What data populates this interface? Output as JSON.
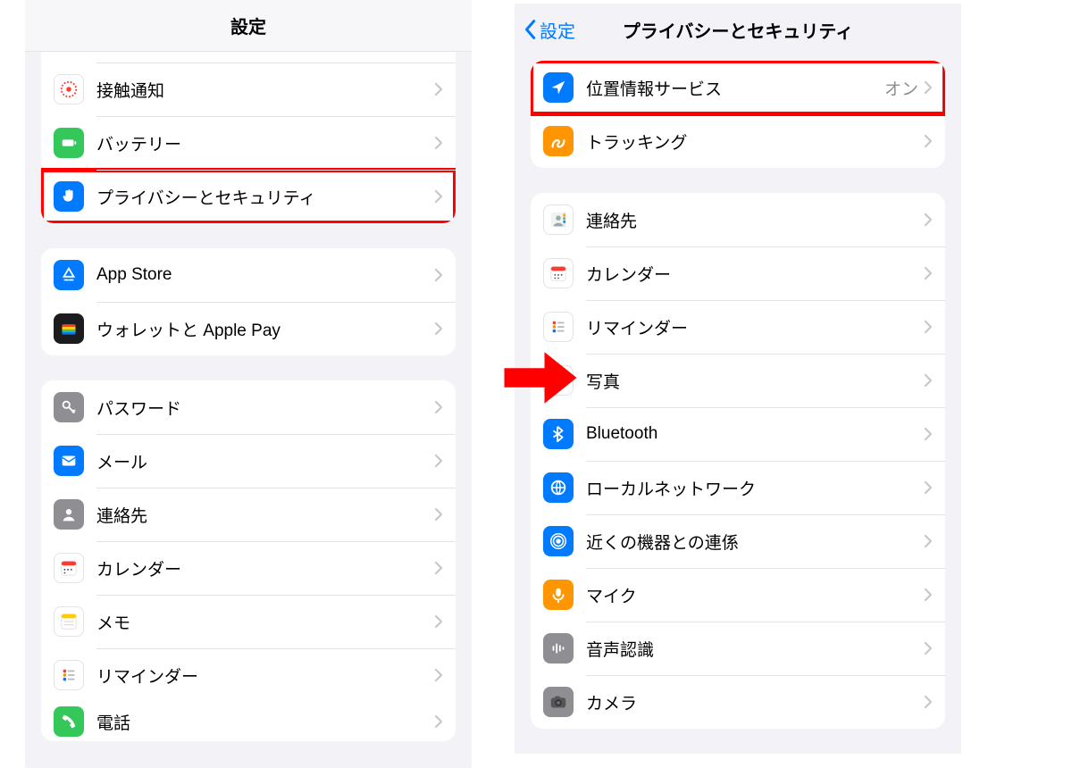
{
  "left": {
    "title": "設定",
    "groups": [
      {
        "cutTop": true,
        "rows": [
          {
            "id": "stub",
            "label": "",
            "icon": "stub"
          },
          {
            "id": "exposure",
            "label": "接触通知",
            "icon": "exposure"
          },
          {
            "id": "battery",
            "label": "バッテリー",
            "icon": "battery"
          },
          {
            "id": "privacy",
            "label": "プライバシーとセキュリティ",
            "icon": "hand",
            "highlight": true
          }
        ]
      },
      {
        "rows": [
          {
            "id": "appstore",
            "label": "App Store",
            "icon": "appstore"
          },
          {
            "id": "wallet",
            "label": "ウォレットと Apple Pay",
            "icon": "wallet"
          }
        ]
      },
      {
        "bottomCut": true,
        "rows": [
          {
            "id": "passwords",
            "label": "パスワード",
            "icon": "key"
          },
          {
            "id": "mail",
            "label": "メール",
            "icon": "mail"
          },
          {
            "id": "contacts-l",
            "label": "連絡先",
            "icon": "contacts-l"
          },
          {
            "id": "calendar-l",
            "label": "カレンダー",
            "icon": "calendar-l"
          },
          {
            "id": "notes",
            "label": "メモ",
            "icon": "notes"
          },
          {
            "id": "reminders-l",
            "label": "リマインダー",
            "icon": "reminders"
          },
          {
            "id": "phone",
            "label": "電話",
            "icon": "phone",
            "half": true
          }
        ]
      }
    ]
  },
  "right": {
    "back": "設定",
    "title": "プライバシーとセキュリティ",
    "groups": [
      {
        "rows": [
          {
            "id": "location",
            "label": "位置情報サービス",
            "value": "オン",
            "icon": "location",
            "highlight": true
          },
          {
            "id": "tracking",
            "label": "トラッキング",
            "icon": "tracking"
          }
        ]
      },
      {
        "rows": [
          {
            "id": "contacts",
            "label": "連絡先",
            "icon": "contacts"
          },
          {
            "id": "calendar",
            "label": "カレンダー",
            "icon": "calendar"
          },
          {
            "id": "reminders",
            "label": "リマインダー",
            "icon": "reminders"
          },
          {
            "id": "photos",
            "label": "写真",
            "icon": "photos"
          },
          {
            "id": "bluetooth",
            "label": "Bluetooth",
            "icon": "bluetooth"
          },
          {
            "id": "localnet",
            "label": "ローカルネットワーク",
            "icon": "localnet"
          },
          {
            "id": "nearby",
            "label": "近くの機器との連係",
            "icon": "nearby"
          },
          {
            "id": "mic",
            "label": "マイク",
            "icon": "mic"
          },
          {
            "id": "speech",
            "label": "音声認識",
            "icon": "speech"
          },
          {
            "id": "camera",
            "label": "カメラ",
            "icon": "camera"
          }
        ]
      }
    ]
  }
}
